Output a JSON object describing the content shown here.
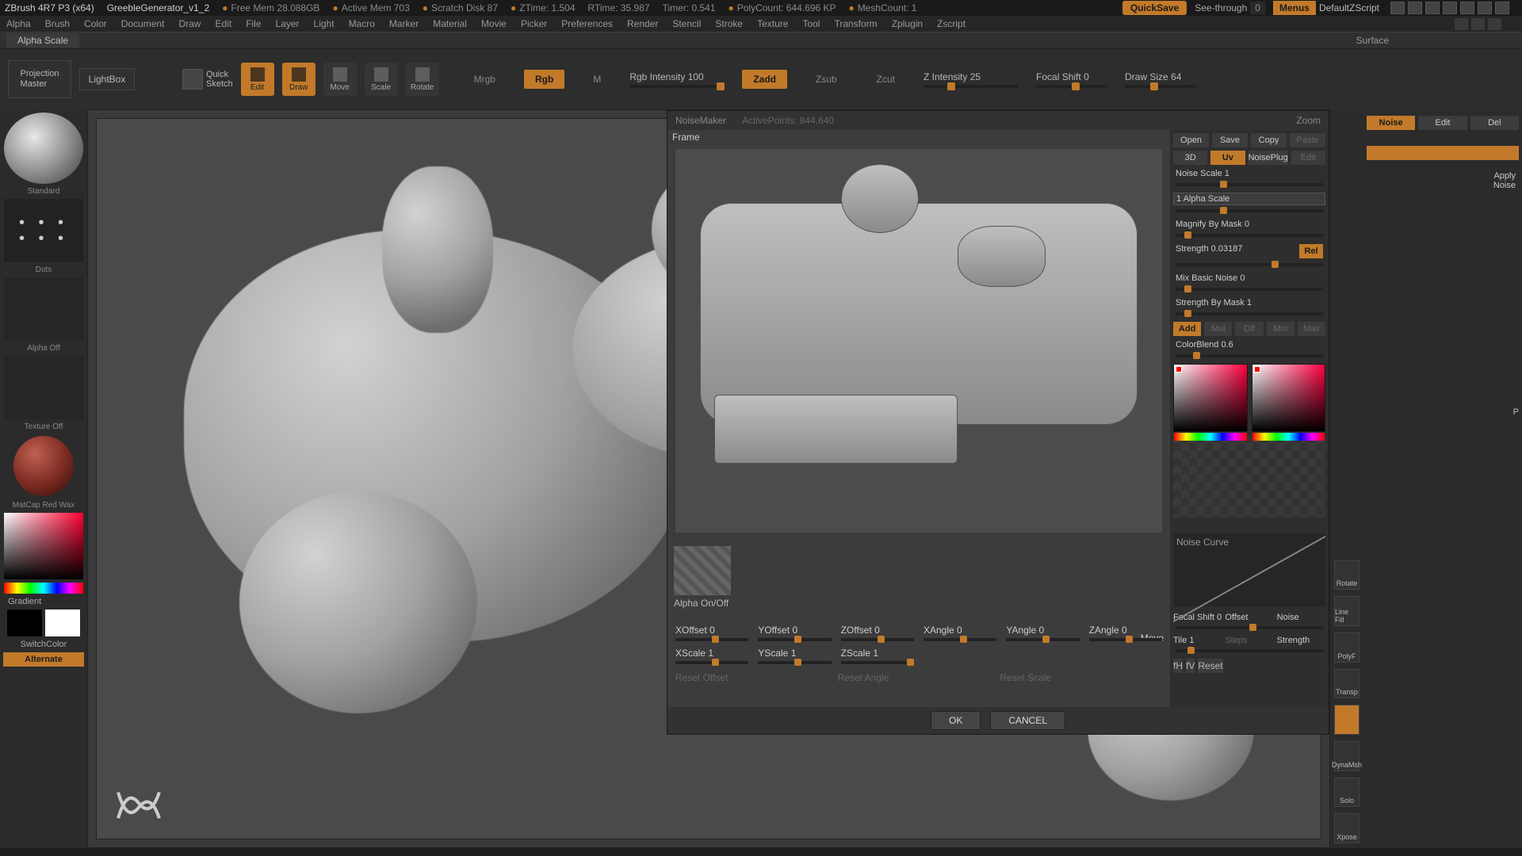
{
  "title": {
    "app": "ZBrush 4R7 P3 (x64)",
    "doc": "GreebleGenerator_v1_2",
    "free_mem": "Free Mem 28.088GB",
    "active_mem": "Active Mem 703",
    "scratch": "Scratch Disk 87",
    "ztime": "ZTime: 1.504",
    "rtime": "RTime: 35.987",
    "timer": "Timer: 0.541",
    "poly": "PolyCount: 644.696 KP",
    "mesh": "MeshCount: 1",
    "quicksave": "QuickSave",
    "seethru": "See-through",
    "seethru_val": "0",
    "menus": "Menus",
    "defscript": "DefaultZScript"
  },
  "menu": [
    "Alpha",
    "Brush",
    "Color",
    "Document",
    "Draw",
    "Edit",
    "File",
    "Layer",
    "Light",
    "Macro",
    "Marker",
    "Material",
    "Movie",
    "Picker",
    "Preferences",
    "Render",
    "Stencil",
    "Stroke",
    "Texture",
    "Tool",
    "Transform",
    "Zplugin",
    "Zscript"
  ],
  "status_current": "Alpha Scale",
  "surface_subtitle": "Surface",
  "toolbar": {
    "projection_master": "Projection\nMaster",
    "lightbox": "LightBox",
    "quicksketch": "Quick\nSketch",
    "btns": [
      {
        "name": "Edit",
        "on": true
      },
      {
        "name": "Draw",
        "on": true
      },
      {
        "name": "Move",
        "on": false
      },
      {
        "name": "Scale",
        "on": false
      },
      {
        "name": "Rotate",
        "on": false
      }
    ],
    "modes": [
      {
        "name": "Mrgb",
        "on": false
      },
      {
        "name": "Rgb",
        "on": true
      },
      {
        "name": "M",
        "on": false
      }
    ],
    "rgb_intensity": {
      "label": "Rgb Intensity",
      "value": "100",
      "pct": 100
    },
    "modes2": [
      {
        "name": "Zadd",
        "on": true
      },
      {
        "name": "Zsub",
        "on": false
      },
      {
        "name": "Zcut",
        "on": false
      }
    ],
    "z_intensity": {
      "label": "Z Intensity",
      "value": "25",
      "pct": 25
    },
    "focal_shift": {
      "label": "Focal Shift",
      "value": "0",
      "pct": 50
    },
    "draw_size": {
      "label": "Draw Size",
      "value": "64",
      "pct": 35
    }
  },
  "left": {
    "brush_caption": "Standard",
    "stroke_caption": "Dots",
    "alpha_caption": "Alpha Off",
    "texture_caption": "Texture Off",
    "material_caption": "MatCap Red Wax",
    "gradient": "Gradient",
    "switchcolor": "SwitchColor",
    "alternate": "Alternate"
  },
  "noisemaker": {
    "title": "NoiseMaker",
    "active_points": "ActivePoints: 844,640",
    "frame": "Frame",
    "zoom": "Zoom",
    "alpha_btn": "Alpha On/Off",
    "move": "Move",
    "offsets": [
      {
        "label": "XOffset",
        "val": "0",
        "pct": 50
      },
      {
        "label": "YOffset",
        "val": "0",
        "pct": 50
      },
      {
        "label": "ZOffset",
        "val": "0",
        "pct": 50
      },
      {
        "label": "XAngle",
        "val": "0",
        "pct": 50
      },
      {
        "label": "YAngle",
        "val": "0",
        "pct": 50
      },
      {
        "label": "ZAngle",
        "val": "0",
        "pct": 50
      },
      {
        "label": "XScale",
        "val": "1",
        "pct": 50
      },
      {
        "label": "YScale",
        "val": "1",
        "pct": 50
      },
      {
        "label": "ZScale",
        "val": "1",
        "pct": 100
      }
    ],
    "resets": [
      "Reset Offset",
      "Reset Angle",
      "Reset Scale"
    ],
    "ok": "OK",
    "cancel": "CANCEL",
    "right": {
      "osc": [
        "Open",
        "Save",
        "Copy",
        "Paste"
      ],
      "uv": [
        "3D",
        "Uv",
        "NoisePlug",
        "Edit"
      ],
      "noise_scale": {
        "label": "Noise Scale",
        "value": "1",
        "pct": 30
      },
      "alpha_scale": {
        "label": "1 Alpha Scale",
        "pct": 30
      },
      "magnify": {
        "label": "Magnify By Mask",
        "value": "0",
        "pct": 6
      },
      "strength": {
        "label": "Strength",
        "value": "0.03187",
        "pct": 65
      },
      "rel": "Rel",
      "mix": {
        "label": "Mix Basic Noise",
        "value": "0",
        "pct": 6
      },
      "strmask": {
        "label": "Strength By Mask",
        "value": "1",
        "pct": 6
      },
      "blend_modes": [
        "Add",
        "Mul",
        "Dif",
        "Min",
        "Max"
      ],
      "colorblend": {
        "label": "ColorBlend",
        "value": "0.6",
        "pct": 12
      },
      "curve_label": "Noise Curve",
      "row_focal": {
        "label": "Focal Shift",
        "value": "0"
      },
      "row_offset": "Offset",
      "row_noise": "Noise",
      "row_tile": {
        "label": "Tile",
        "value": "1"
      },
      "row_steps": "Steps",
      "row_strength": "Strength",
      "fh": "fH",
      "fv": "fV",
      "reset": "Reset"
    }
  },
  "rpanel": {
    "header": "Surface",
    "row1": [
      "Noise",
      "Edit",
      "Del"
    ],
    "applynoise": "Apply\nNoise",
    "p": "P"
  },
  "rstrip": [
    "Rotate",
    "Line Fill",
    "PolyF",
    "Transp",
    "",
    "DynaMsh",
    "Solo",
    "Xpose"
  ]
}
